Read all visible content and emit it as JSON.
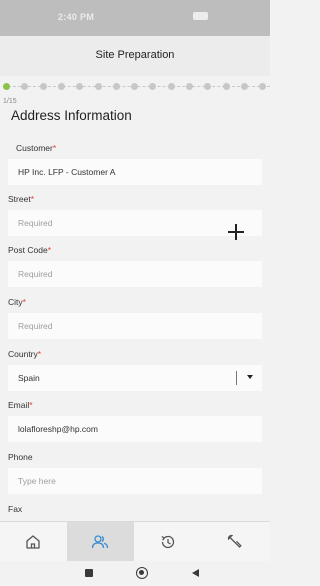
{
  "status_bar": {
    "time": "2:40 PM",
    "icons": [
      "notification-icons",
      "signal-icon",
      "wifi-icon",
      "battery-icon"
    ]
  },
  "header": {
    "title": "Site Preparation"
  },
  "stepper": {
    "total_steps": 15,
    "current_step": 1
  },
  "page_indicator": "1/15",
  "section_title": "Address Information",
  "fields": {
    "customer": {
      "label": "Customer",
      "required_mark": "*",
      "value": "HP Inc. LFP - Customer A"
    },
    "street": {
      "label": "Street",
      "required_mark": "*",
      "placeholder": "Required"
    },
    "post_code": {
      "label": "Post Code",
      "required_mark": "*",
      "placeholder": "Required"
    },
    "city": {
      "label": "City",
      "required_mark": "*",
      "placeholder": "Required"
    },
    "country": {
      "label": "Country",
      "required_mark": "*",
      "value": "Spain"
    },
    "email": {
      "label": "Email",
      "required_mark": "*",
      "value": "lolafloreshp@hp.com"
    },
    "phone": {
      "label": "Phone",
      "placeholder": "Type here"
    },
    "fax": {
      "label": "Fax"
    }
  },
  "tab_bar": {
    "items": [
      "home-icon",
      "people-icon",
      "history-icon",
      "wrench-icon"
    ],
    "active": "people-icon",
    "active_color": "#3b8bd1"
  },
  "colors": {
    "required": "#e53935",
    "step_active": "#8bc34a",
    "step_inactive": "#c7c7c7"
  }
}
